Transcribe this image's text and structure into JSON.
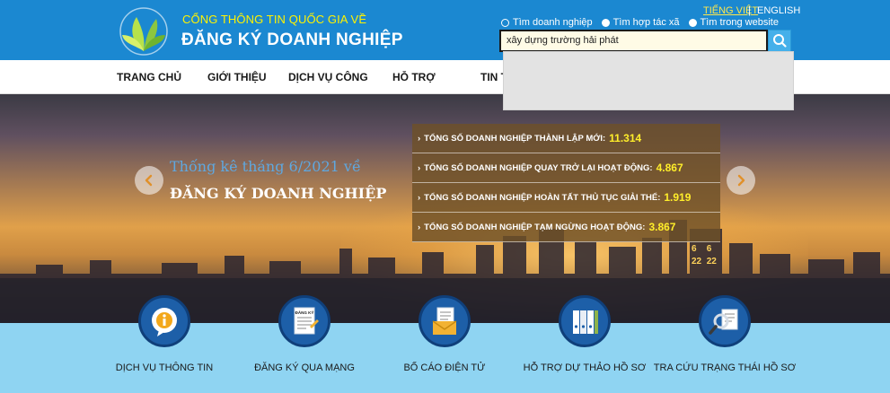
{
  "header": {
    "brand_top": "CỔNG THÔNG TIN QUỐC GIA VỀ",
    "brand_main": "ĐĂNG KÝ DOANH NGHIỆP",
    "lang_vi": "TIẾNG VIỆT",
    "lang_sep": "|",
    "lang_en": "ENGLISH",
    "search_options": [
      {
        "label": "Tìm doanh nghiệp",
        "selected": false
      },
      {
        "label": "Tìm hợp tác xã",
        "selected": true
      },
      {
        "label": "Tìm trong website",
        "selected": true
      }
    ],
    "search_value": "xây dựng trường hải phát",
    "colors": {
      "header_bg": "#1b88d1",
      "brand_top": "#fff200",
      "lang_active": "#ffe74a"
    }
  },
  "nav": {
    "items": [
      "TRANG CHỦ",
      "GIỚI THIỆU",
      "DỊCH VỤ CÔNG",
      "HỖ TRỢ",
      "TIN T"
    ]
  },
  "hero": {
    "line1": "Thống kê tháng 6/2021 về",
    "line2": "ĐĂNG KÝ DOANH NGHIỆP",
    "stats": [
      {
        "label": "TỔNG SỐ DOANH NGHIỆP THÀNH LẬP MỚI:",
        "value": "11.314"
      },
      {
        "label": "TỔNG SỐ DOANH NGHIỆP QUAY TRỞ LẠI HOẠT ĐỘNG:",
        "value": "4.867"
      },
      {
        "label": "TỔNG SỐ DOANH NGHIỆP HOÀN TẤT THỦ TỤC GIẢI THỂ:",
        "value": "1.919"
      },
      {
        "label": "TỔNG SỐ DOANH NGHIỆP TẠM NGỪNG HOẠT ĐỘNG:",
        "value": "3.867"
      }
    ],
    "tower_digits": [
      "6",
      "6",
      "22",
      "22"
    ]
  },
  "services": [
    {
      "label": "DỊCH VỤ THÔNG TIN",
      "icon": "info-icon"
    },
    {
      "label": "ĐĂNG KÝ QUA MẠNG",
      "icon": "form-icon",
      "icon_text": "ĐĂNG KÝ"
    },
    {
      "label": "BỐ CÁO ĐIỆN TỬ",
      "icon": "envelope-icon"
    },
    {
      "label": "HỖ TRỢ DỰ THẢO HỒ SƠ",
      "icon": "binders-icon"
    },
    {
      "label": "TRA CỨU TRẠNG THÁI HỒ SƠ",
      "icon": "magnifier-document-icon"
    }
  ]
}
